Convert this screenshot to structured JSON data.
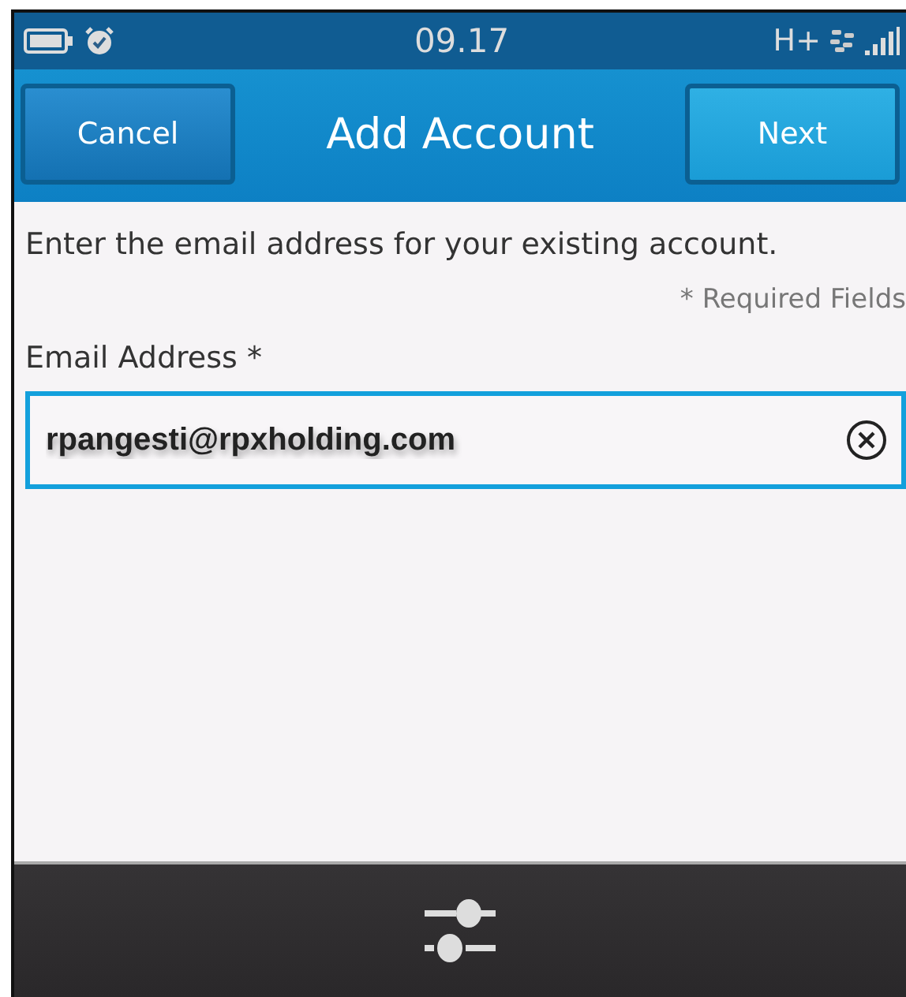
{
  "status_bar": {
    "time": "09.17",
    "network": "H+"
  },
  "header": {
    "title": "Add Account",
    "buttons": [
      {
        "label": "Cancel",
        "kind": "secondary"
      },
      {
        "label": "Next",
        "kind": "primary"
      }
    ]
  },
  "intro": "Enter the email address for your existing account.",
  "required_note": "* Required Fields",
  "fields": [
    {
      "label": "Email Address *",
      "value": "rpangesti@rpxholding.com",
      "focused": true
    }
  ]
}
